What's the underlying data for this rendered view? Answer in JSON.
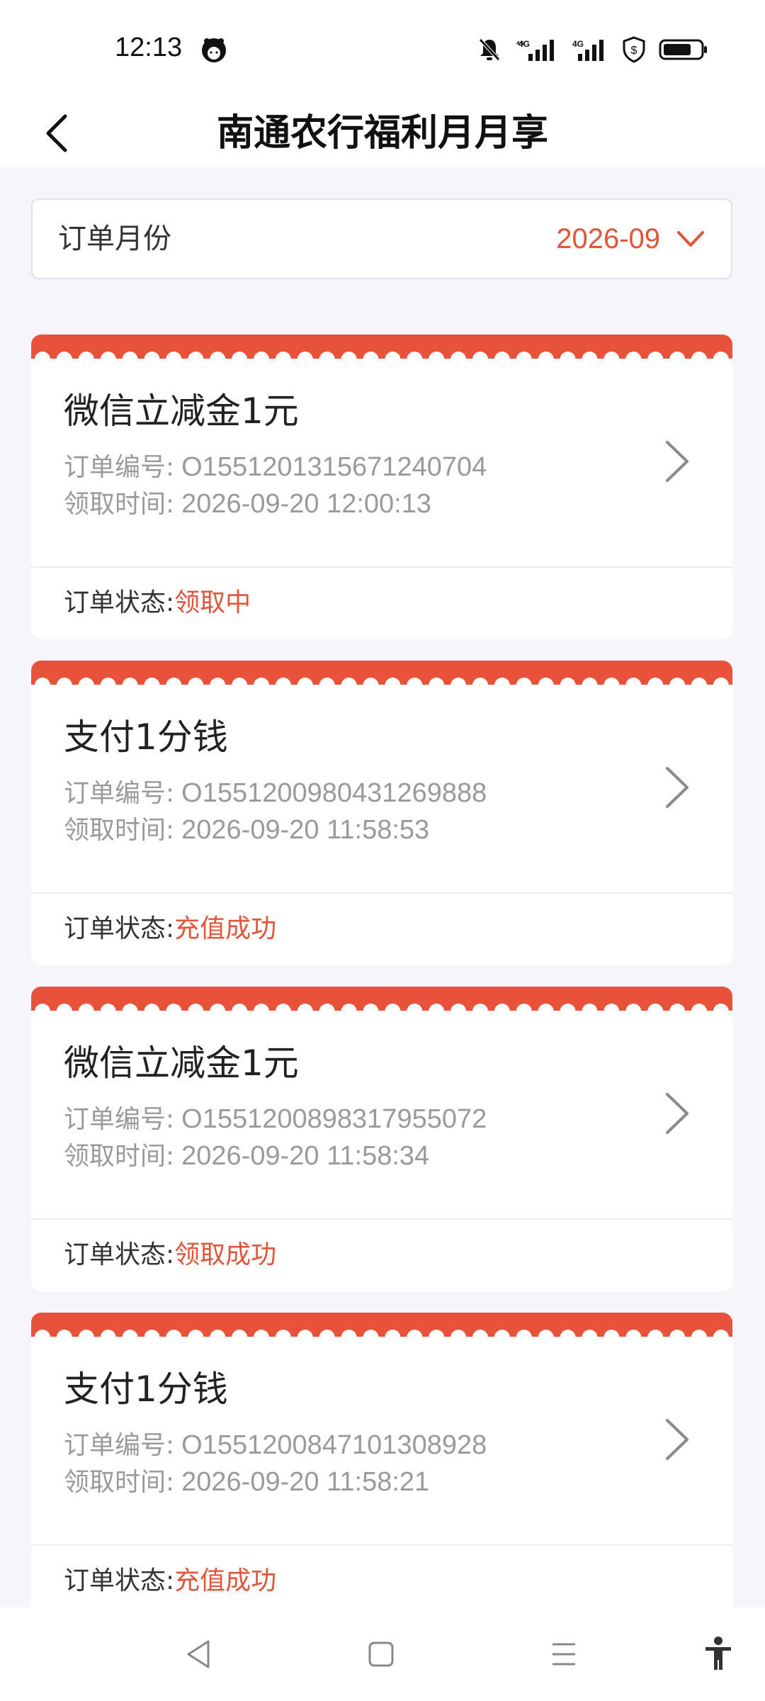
{
  "status_bar": {
    "time": "12:13",
    "icons": [
      "app-notification-icon",
      "mute-bell-icon",
      "signal-4g-1-icon",
      "signal-4g-2-icon",
      "security-shield-icon",
      "battery-icon"
    ]
  },
  "header": {
    "back_icon": "back-arrow-icon",
    "title": "南通农行福利月月享"
  },
  "month_selector": {
    "label": "订单月份",
    "value": "2026-09",
    "icon": "chevron-down-icon"
  },
  "orders": [
    {
      "name": "微信立减金1元",
      "order_no_label": "订单编号:",
      "order_no": "O1551201315671240704",
      "time_label": "领取时间:",
      "time": "2026-09-20 12:00:13",
      "status_label": "订单状态:",
      "status": "领取中"
    },
    {
      "name": "支付1分钱",
      "order_no_label": "订单编号:",
      "order_no": "O1551200980431269888",
      "time_label": "领取时间:",
      "time": "2026-09-20 11:58:53",
      "status_label": "订单状态:",
      "status": "充值成功"
    },
    {
      "name": "微信立减金1元",
      "order_no_label": "订单编号:",
      "order_no": "O1551200898317955072",
      "time_label": "领取时间:",
      "time": "2026-09-20 11:58:34",
      "status_label": "订单状态:",
      "status": "领取成功"
    },
    {
      "name": "支付1分钱",
      "order_no_label": "订单编号:",
      "order_no": "O1551200847101308928",
      "time_label": "领取时间:",
      "time": "2026-09-20 11:58:21",
      "status_label": "订单状态:",
      "status": "充值成功"
    }
  ],
  "nav_bar": {
    "icons": [
      "nav-back-icon",
      "nav-home-icon",
      "nav-menu-icon",
      "accessibility-icon"
    ]
  },
  "colors": {
    "accent": "#e2553a",
    "ticket_edge": "#e8523a",
    "background": "#f5f5fa"
  }
}
